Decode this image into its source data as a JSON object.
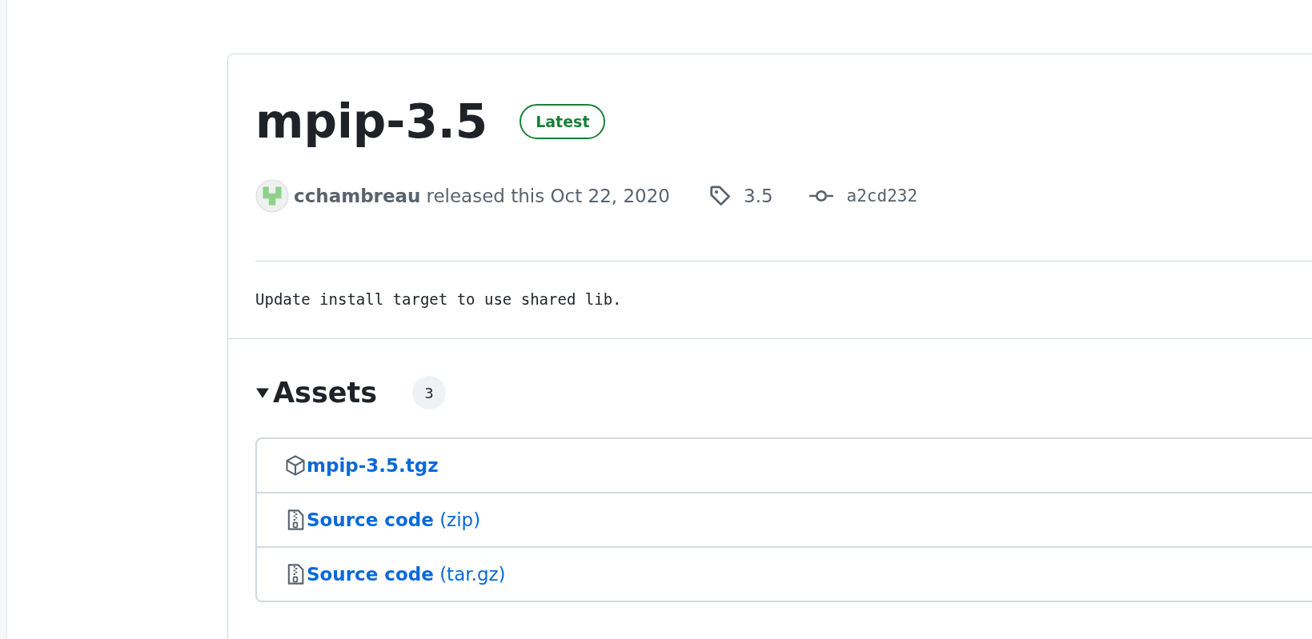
{
  "release": {
    "title": "mpip-3.5",
    "badge": "Latest",
    "author": "cchambreau",
    "released_text": "released this Oct 22, 2020",
    "tag": "3.5",
    "commit": "a2cd232",
    "description": "Update install target to use shared lib."
  },
  "assets": {
    "heading": "Assets",
    "expanded": true,
    "count": "3",
    "items": [
      {
        "kind": "package",
        "label": "mpip-3.5.tgz"
      },
      {
        "kind": "zip",
        "label": "**Source code** (zip)"
      },
      {
        "kind": "zip",
        "label": "**Source code** (tar.gz)"
      }
    ]
  }
}
